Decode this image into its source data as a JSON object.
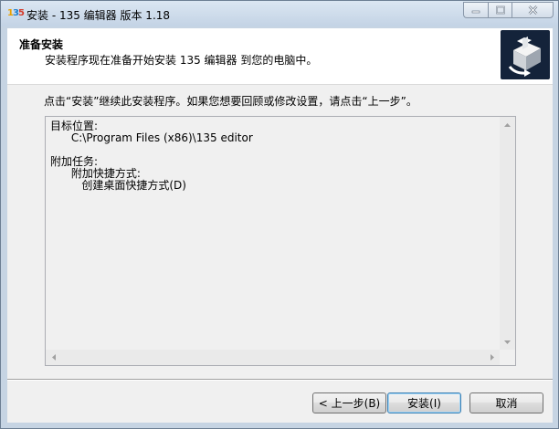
{
  "window": {
    "title": "安装 - 135 编辑器 版本 1.18",
    "app_icon_text": [
      "1",
      "3",
      "5"
    ]
  },
  "header": {
    "title": "准备安装",
    "subtitle": "安装程序现在准备开始安装 135 编辑器 到您的电脑中。"
  },
  "intro": "点击“安装”继续此安装程序。如果您想要回顾或修改设置，请点击“上一步”。",
  "memo": {
    "lines": [
      "目标位置:",
      "      C:\\Program Files (x86)\\135 editor",
      "",
      "附加任务:",
      "      附加快捷方式:",
      "         创建桌面快捷方式(D)"
    ]
  },
  "buttons": {
    "back": "< 上一步(B)",
    "install": "安装(I)",
    "cancel": "取消"
  },
  "colors": {
    "titlebar": "#c3d3e5",
    "logo_bg": "#14233a",
    "default_button_border": "#3c7fb1"
  },
  "icons": [
    "minimize-icon",
    "maximize-icon",
    "close-icon",
    "installer-logo",
    "scroll-up-icon",
    "scroll-down-icon",
    "scroll-left-icon",
    "scroll-right-icon"
  ]
}
